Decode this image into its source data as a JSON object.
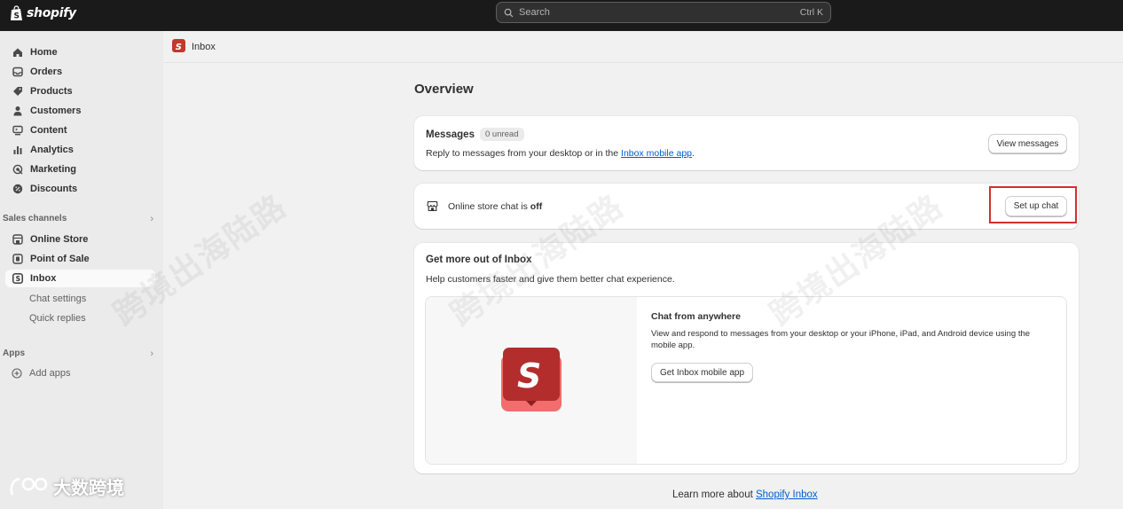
{
  "topbar": {
    "logo_text": "shopify",
    "search_placeholder": "Search",
    "search_shortcut": "Ctrl K"
  },
  "sidebar": {
    "items": [
      {
        "label": "Home",
        "icon": "home-icon"
      },
      {
        "label": "Orders",
        "icon": "inbox-tray-icon"
      },
      {
        "label": "Products",
        "icon": "tag-icon"
      },
      {
        "label": "Customers",
        "icon": "person-icon"
      },
      {
        "label": "Content",
        "icon": "content-icon"
      },
      {
        "label": "Analytics",
        "icon": "bar-chart-icon"
      },
      {
        "label": "Marketing",
        "icon": "target-icon"
      },
      {
        "label": "Discounts",
        "icon": "discount-icon"
      }
    ],
    "sales_channels_label": "Sales channels",
    "channels": [
      {
        "label": "Online Store",
        "icon": "store-icon"
      },
      {
        "label": "Point of Sale",
        "icon": "pos-icon"
      },
      {
        "label": "Inbox",
        "icon": "inbox-app-icon"
      }
    ],
    "inbox_sub": [
      "Chat settings",
      "Quick replies"
    ],
    "apps_label": "Apps",
    "add_apps_label": "Add apps"
  },
  "pagebar": {
    "breadcrumb": "Inbox"
  },
  "main": {
    "title": "Overview",
    "messages_card": {
      "title": "Messages",
      "badge": "0 unread",
      "description_prefix": "Reply to messages from your desktop or in the ",
      "description_link": "Inbox mobile app",
      "description_suffix": ".",
      "button": "View messages"
    },
    "chat_card": {
      "text_prefix": "Online store chat is ",
      "text_status": "off",
      "button": "Set up chat"
    },
    "promo_card": {
      "title": "Get more out of Inbox",
      "description": "Help customers faster and give them better chat experience.",
      "feature_title": "Chat from anywhere",
      "feature_description": "View and respond to messages from your desktop or your iPhone, iPad, and Android device using the mobile app.",
      "feature_button": "Get Inbox mobile app"
    },
    "footer_prefix": "Learn more about ",
    "footer_link": "Shopify Inbox"
  },
  "watermark": {
    "text": "跨境出海陆路",
    "brand": "大数跨境"
  },
  "colors": {
    "topbar": "#1a1a1a",
    "accent_link": "#005bd3",
    "inbox_red": "#c0392b",
    "highlight": "#d22f2f"
  }
}
